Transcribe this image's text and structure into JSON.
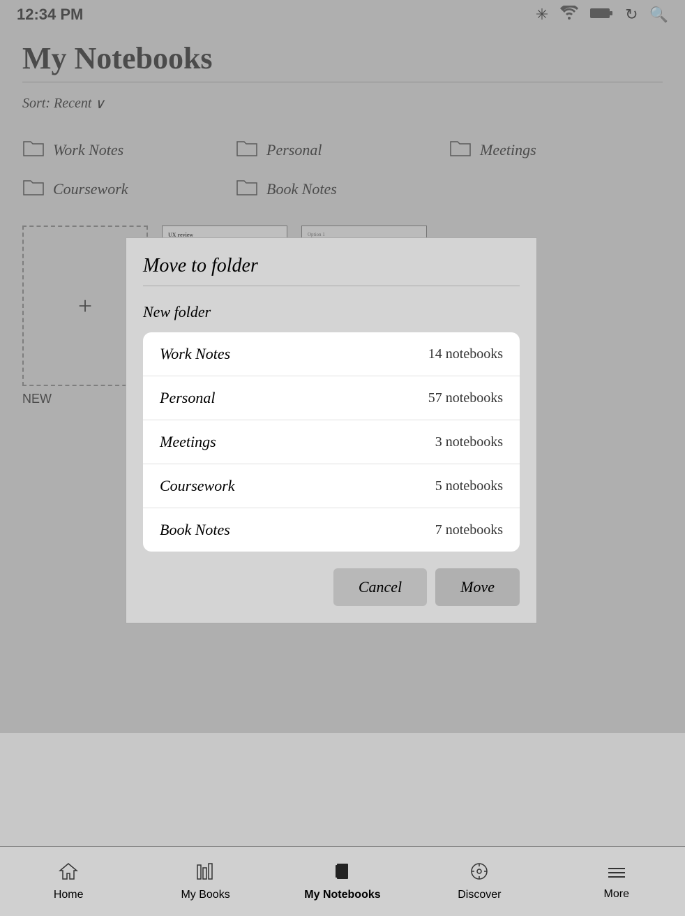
{
  "statusBar": {
    "time": "12:34 PM"
  },
  "header": {
    "title": "My Notebooks"
  },
  "sort": {
    "label": "Sort: Recent",
    "chevron": "∨"
  },
  "folders": [
    {
      "name": "Work Notes"
    },
    {
      "name": "Personal"
    },
    {
      "name": "Meetings"
    },
    {
      "name": "Coursework"
    },
    {
      "name": "Book Notes"
    }
  ],
  "newNotebook": {
    "label": "NEW"
  },
  "dialog": {
    "title": "Move to folder",
    "newFolder": "New folder",
    "folders": [
      {
        "name": "Work Notes",
        "count": "14 notebooks"
      },
      {
        "name": "Personal",
        "count": "57 notebooks"
      },
      {
        "name": "Meetings",
        "count": "3 notebooks"
      },
      {
        "name": "Coursework",
        "count": "5 notebooks"
      },
      {
        "name": "Book Notes",
        "count": "7 notebooks"
      }
    ],
    "cancelLabel": "Cancel",
    "moveLabel": "Move"
  },
  "bottomNav": {
    "items": [
      {
        "id": "home",
        "label": "Home",
        "icon": "⌂",
        "active": false
      },
      {
        "id": "my-books",
        "label": "My Books",
        "icon": "📊",
        "active": false
      },
      {
        "id": "my-notebooks",
        "label": "My Notebooks",
        "icon": "📓",
        "active": true
      },
      {
        "id": "discover",
        "label": "Discover",
        "icon": "◎",
        "active": false
      },
      {
        "id": "more",
        "label": "More",
        "icon": "≡",
        "active": false
      }
    ]
  }
}
